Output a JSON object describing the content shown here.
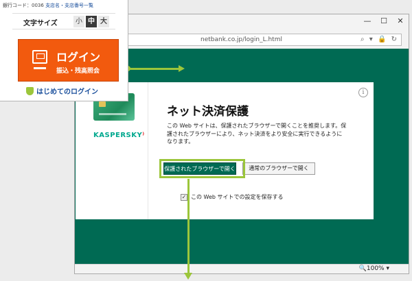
{
  "bank_panel": {
    "code_label": "銀行コード：0036",
    "branch_link": "支店名・支店番号一覧",
    "font_size_label": "文字サイズ",
    "font_small": "小",
    "font_medium": "中",
    "font_large": "大",
    "login_title": "ログイン",
    "login_subtitle": "振込・残高照会",
    "first_login": "はじめてのログイン"
  },
  "browser": {
    "address_text": "netbank.co.jp/login_L.html",
    "address_icons": "⌕ ▾ 🔒 ↻",
    "zoom": "🔍100% ▾",
    "window_controls": [
      "—",
      "☐",
      "✕"
    ]
  },
  "dialog": {
    "vendor": "KASPERSKY",
    "vendor_mark": "⁾",
    "info": "i",
    "title": "ネット決済保護",
    "description": "この Web サイトは、保護されたブラウザーで開くことを推奨します。保護されたブラウザーにより、ネット決済をより安全に実行できるようになります。",
    "button_protected": "保護されたブラウザーで開く",
    "button_normal": "通常のブラウザーで開く",
    "checkbox_label": "この Web サイトでの設定を保存する",
    "checkbox_checked": true
  },
  "colors": {
    "accent_green": "#9cc63b",
    "kaspersky_green": "#006a53",
    "login_orange": "#f25a0e"
  }
}
